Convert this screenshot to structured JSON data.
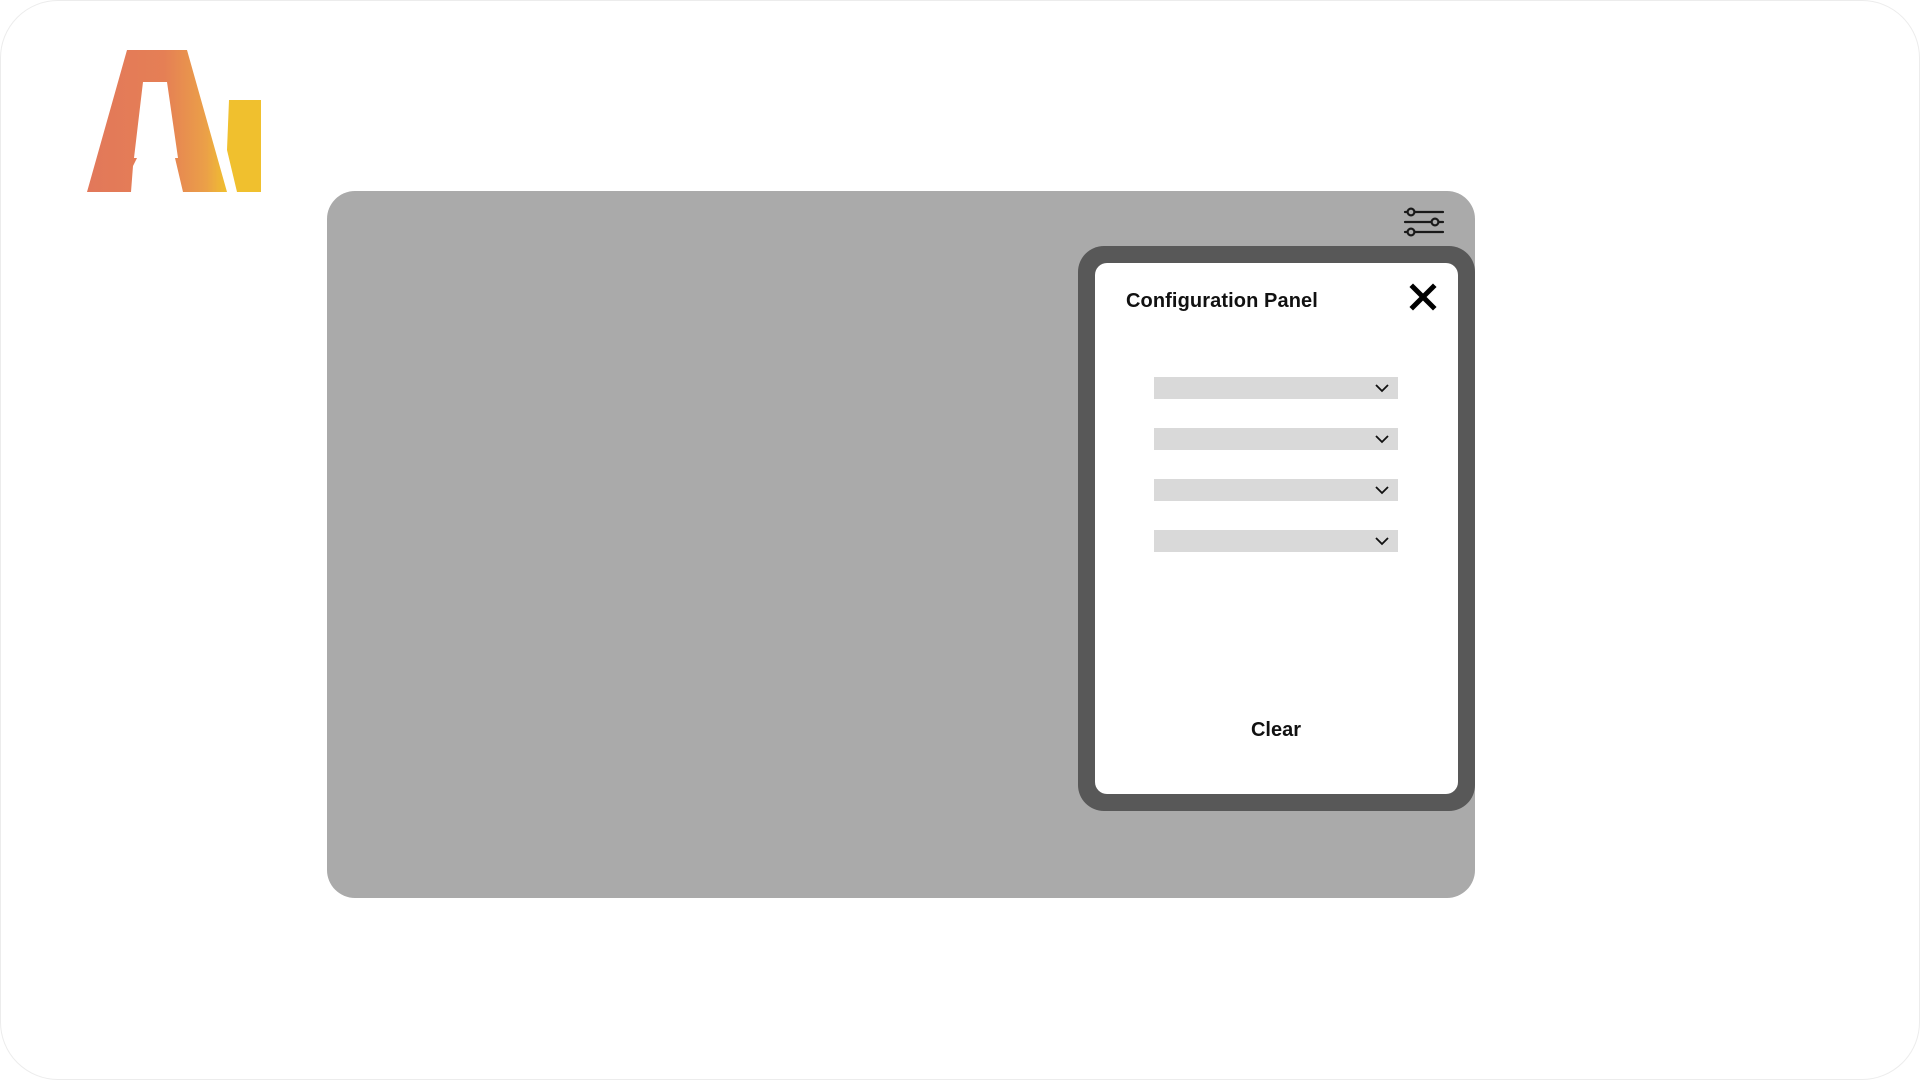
{
  "app": {
    "logo_icon": "ai-logo-icon",
    "logo_colors": {
      "orange": "#E2785A",
      "yellow": "#F0C02E"
    }
  },
  "canvas": {
    "background": "#AAAAAA",
    "settings_icon": "sliders-icon"
  },
  "config_panel": {
    "title": "Configuration Panel",
    "close_icon": "close-icon",
    "dropdowns": [
      {
        "value": "",
        "icon": "chevron-down-icon"
      },
      {
        "value": "",
        "icon": "chevron-down-icon"
      },
      {
        "value": "",
        "icon": "chevron-down-icon"
      },
      {
        "value": "",
        "icon": "chevron-down-icon"
      }
    ],
    "clear_label": "Clear",
    "frame_color": "#585858"
  }
}
